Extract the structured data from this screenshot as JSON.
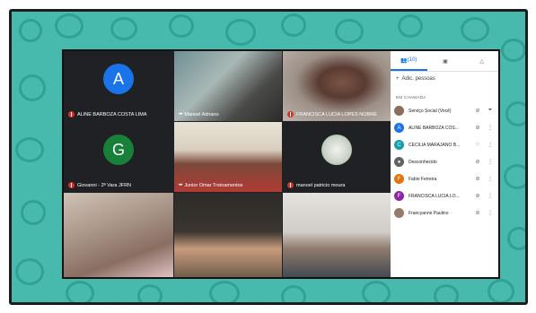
{
  "tiles": [
    {
      "label": "ALINE BARBOZA COSTA LIMA",
      "initial": "A",
      "avatar_color": "#1a73e8",
      "muted": true
    },
    {
      "label": "Manoel Adriano",
      "muted": false
    },
    {
      "label": "FRANCISCA LUCIA LOPES NOBRE",
      "muted": true
    },
    {
      "label": "Giovanni - 2ª Vara JFRN",
      "initial": "G",
      "avatar_color": "#188038",
      "muted": true
    },
    {
      "label": "Junior Omar Treinamentos",
      "muted": false
    },
    {
      "label": "manoel patricio moura",
      "muted": true
    }
  ],
  "panel": {
    "people_count": "(10)",
    "add_people": "Adic. pessoas",
    "section": "EM CHAMADA",
    "participants": [
      {
        "name": "Serviço Social (Você)",
        "initial": "",
        "color": "#8a6d5a"
      },
      {
        "name": "ALINE BARBOZA COS...",
        "initial": "A",
        "color": "#1a73e8"
      },
      {
        "name": "CECÍLIA MARAJANO B...",
        "initial": "C",
        "color": "#129eaf"
      },
      {
        "name": "Desconhecido",
        "initial": "",
        "color": "#5f6368"
      },
      {
        "name": "Fabio Ferreira",
        "initial": "F",
        "color": "#e8710a"
      },
      {
        "name": "FRANCISCA LUCIA LO...",
        "initial": "F",
        "color": "#8e24aa"
      },
      {
        "name": "Francyanne Paulino",
        "initial": "",
        "color": "#9a7b6a"
      }
    ]
  },
  "colors": {
    "frame": "#48b9ad",
    "meet_bg": "#202124",
    "accent": "#1a73e8",
    "mute": "#d93025"
  }
}
